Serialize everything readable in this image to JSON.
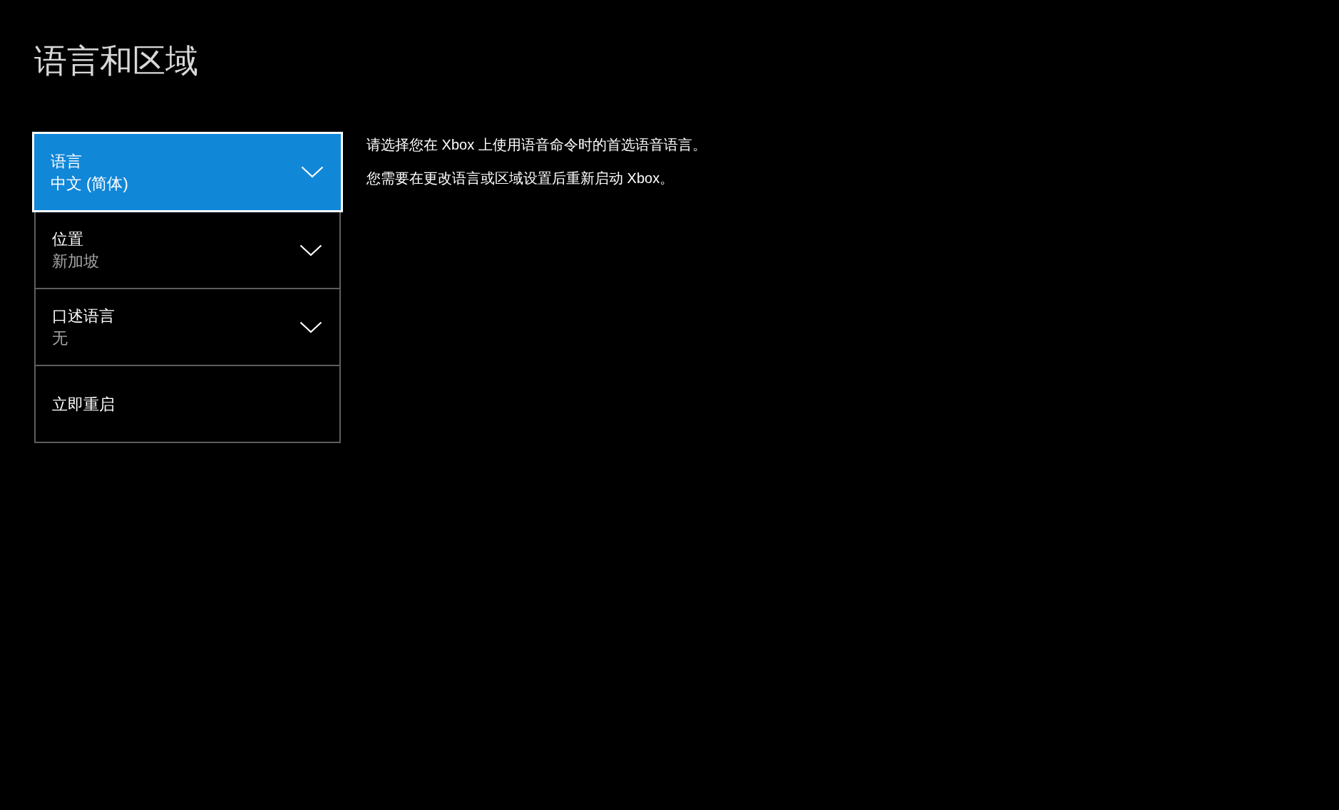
{
  "title": "语言和区域",
  "settings": [
    {
      "kind": "dropdown",
      "label": "语言",
      "value": "中文 (简体)",
      "selected": true
    },
    {
      "kind": "dropdown",
      "label": "位置",
      "value": "新加坡",
      "selected": false
    },
    {
      "kind": "dropdown",
      "label": "口述语言",
      "value": "无",
      "selected": false
    },
    {
      "kind": "action",
      "label": "立即重启",
      "selected": false
    }
  ],
  "description": [
    "请选择您在 Xbox 上使用语音命令时的首选语音语言。",
    "您需要在更改语言或区域设置后重新启动 Xbox。"
  ]
}
